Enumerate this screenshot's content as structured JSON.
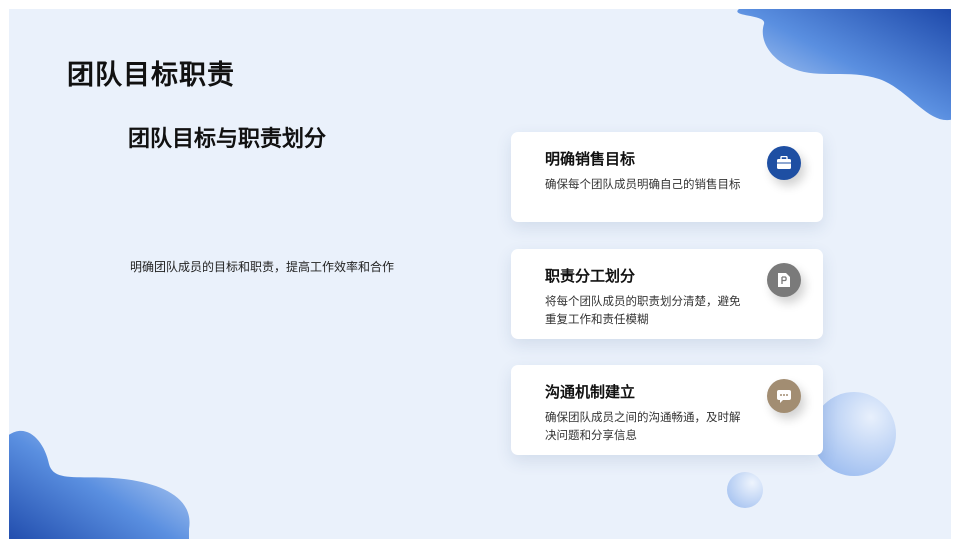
{
  "title": "团队目标职责",
  "subtitle": "团队目标与职责划分",
  "description": "明确团队成员的目标和职责，提高工作效率和合作",
  "cards": [
    {
      "title": "明确销售目标",
      "desc": "确保每个团队成员明确自己的销售目标",
      "icon": "briefcase-icon",
      "icon_color": "#1e4fa3"
    },
    {
      "title": "职责分工划分",
      "desc": "将每个团队成员的职责划分清楚，避免重复工作和责任模糊",
      "icon": "document-icon",
      "icon_color": "#7a7a7a"
    },
    {
      "title": "沟通机制建立",
      "desc": "确保团队成员之间的沟通畅通，及时解决问题和分享信息",
      "icon": "chat-icon",
      "icon_color": "#a28d72"
    }
  ],
  "colors": {
    "background": "#eaf1fb",
    "accent": "#1e4fa3"
  }
}
